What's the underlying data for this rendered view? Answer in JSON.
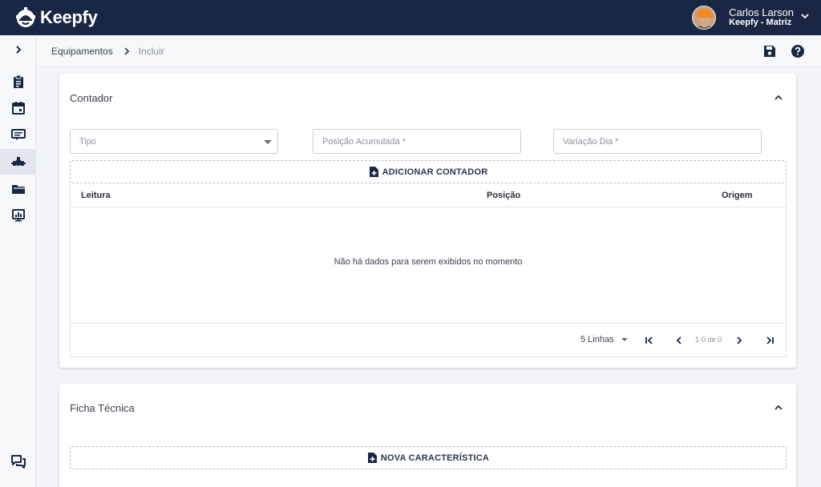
{
  "app": {
    "brand": "Keepfy",
    "user": {
      "name": "Carlos Larson",
      "org": "Keepfy - Matriz"
    }
  },
  "sidebar": {
    "items": [
      {
        "icon": "chevron-right-icon"
      },
      {
        "icon": "clipboard-icon"
      },
      {
        "icon": "calendar-icon"
      },
      {
        "icon": "ticket-icon"
      },
      {
        "icon": "equipment-icon",
        "active": true
      },
      {
        "icon": "folder-icon"
      },
      {
        "icon": "dashboard-icon"
      },
      {
        "icon": "chat-icon"
      }
    ]
  },
  "breadcrumb": {
    "parent": "Equipamentos",
    "current": "Incluir"
  },
  "actions": {
    "save_icon": "save-icon",
    "help_icon": "help-icon"
  },
  "contador": {
    "title": "Contador",
    "fields": {
      "tipo_placeholder": "Tipo",
      "posicao_placeholder": "Posição Acumulada *",
      "variacao_placeholder": "Variação Dia *"
    },
    "add_button": "ADICIONAR CONTADOR",
    "table": {
      "columns": [
        "Leitura",
        "Posição",
        "Origem"
      ],
      "empty_message": "Não há dados para serem exibidos no momento",
      "rows_per_page": "5 Linhas",
      "page_info": "1-0 de 0"
    }
  },
  "ficha": {
    "title": "Ficha Técnica",
    "add_button": "NOVA CARACTERÍSTICA"
  },
  "colors": {
    "topbar": "#1a2744",
    "accent": "#2b3550",
    "background": "#f2f4f8"
  }
}
